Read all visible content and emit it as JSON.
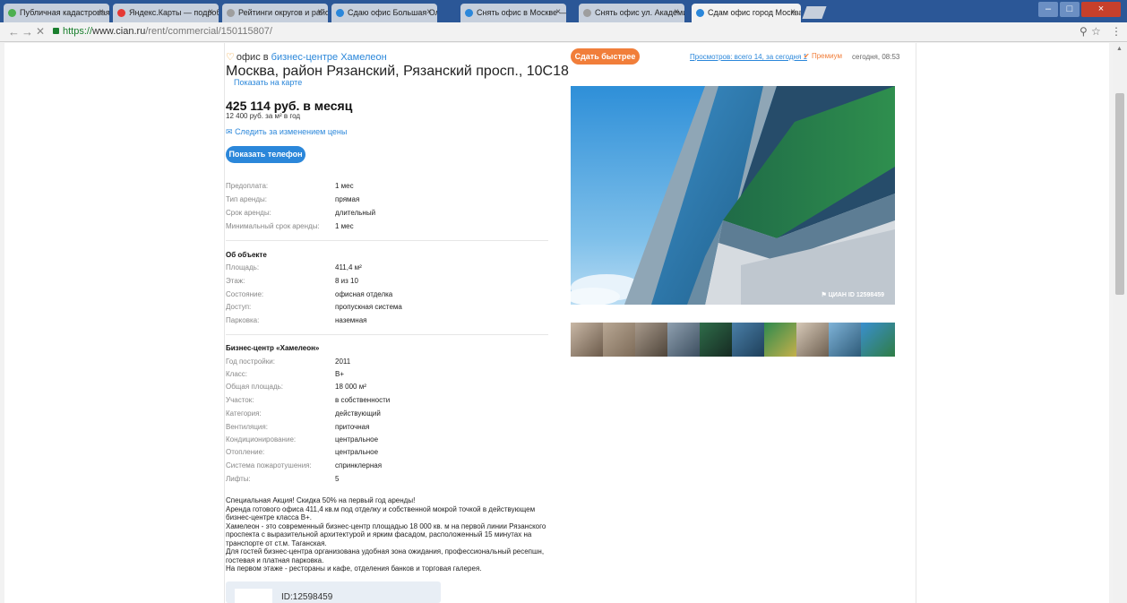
{
  "browser": {
    "tabs": [
      {
        "label": "Публичная кадастровая",
        "active": false
      },
      {
        "label": "Яндекс.Карты — подробно",
        "active": false
      },
      {
        "label": "Рейтинги округов и районов",
        "active": false
      },
      {
        "label": "Сдаю офис Большая Ол",
        "active": false
      },
      {
        "label": "Снять офис в Москве —",
        "active": false
      },
      {
        "label": "Снять офис ул. Академик",
        "active": false
      },
      {
        "label": "Сдам офис город Москва",
        "active": true
      }
    ],
    "url_scheme": "https://",
    "url_host": "www.cian.ru",
    "url_path": "/rent/commercial/150115807/"
  },
  "listing": {
    "type_prefix": "офис в",
    "bc_link": "бизнес-центре Хамелеон",
    "address": "Москва, район Рязанский, Рязанский просп., 10С18",
    "map_link": "Показать на карте",
    "price": "425 114 руб. в месяц",
    "price_per_sqm": "12 400 руб. за м² в год",
    "follow_price": "Следить за изменением цены",
    "show_phone": "Показать телефон",
    "terms": [
      {
        "label": "Предоплата:",
        "value": "1 мес"
      },
      {
        "label": "Тип аренды:",
        "value": "прямая"
      },
      {
        "label": "Срок аренды:",
        "value": "длительный"
      },
      {
        "label": "Минимальный срок аренды:",
        "value": "1 мес"
      }
    ],
    "object_title": "Об объекте",
    "object": [
      {
        "label": "Площадь:",
        "value": "411,4 м²"
      },
      {
        "label": "Этаж:",
        "value": "8 из 10"
      },
      {
        "label": "Состояние:",
        "value": "офисная отделка"
      },
      {
        "label": "Доступ:",
        "value": "пропускная система"
      },
      {
        "label": "Парковка:",
        "value": "наземная"
      }
    ],
    "bc_title": "Бизнес-центр «Хамелеон»",
    "bc": [
      {
        "label": "Год постройки:",
        "value": "2011"
      },
      {
        "label": "Класс:",
        "value": "B+"
      },
      {
        "label": "Общая площадь:",
        "value": "18 000 м²"
      },
      {
        "label": "Участок:",
        "value": "в собственности"
      },
      {
        "label": "Категория:",
        "value": "действующий"
      },
      {
        "label": "Вентиляция:",
        "value": "приточная"
      },
      {
        "label": "Кондиционирование:",
        "value": "центральное"
      },
      {
        "label": "Отопление:",
        "value": "центральное"
      },
      {
        "label": "Система пожаротушения:",
        "value": "спринклерная"
      },
      {
        "label": "Лифты:",
        "value": "5"
      }
    ],
    "description": [
      "Специальная Акция! Скидка 50% на первый год аренды!",
      "Аренда готового офиса 411,4 кв.м под отделку и собственной мокрой точкой в действующем бизнес-центре класса В+.",
      "Хамелеон - это современный бизнес-центр площадью 18 000 кв. м на первой линии Рязанского проспекта с выразительной архитектурой и ярким фасадом, расположенный 15 минутах на транспорте от ст.м. Таганская.",
      "Для гостей бизнес-центра организована удобная зона ожидания, профессиональный ресепшн, гостевая и платная парковка.",
      "На первом этаже - рестораны и кафе, отделения банков и торговая галерея."
    ],
    "agent_id": "ID:12598459",
    "publish_button": "Сдать быстрее",
    "views": "Просмотров: всего 14, за сегодня 1",
    "premium": "Премиум",
    "date": "сегодня, 08:53",
    "watermark": "ЦИАН ID 12598459"
  },
  "colors": {
    "accent": "#2b87da",
    "orange": "#f17e3a"
  }
}
